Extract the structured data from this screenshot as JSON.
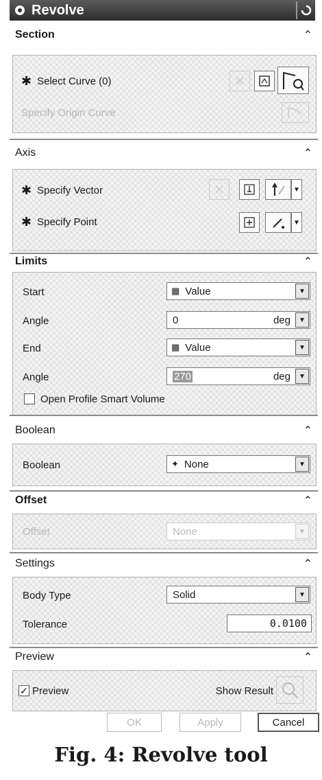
{
  "dialog": {
    "title": "Revolve"
  },
  "section": {
    "header": "Section",
    "select_curve": "Select Curve (0)",
    "specify_origin": "Specify Origin Curve"
  },
  "axis": {
    "header": "Axis",
    "specify_vector": "Specify Vector",
    "specify_point": "Specify Point"
  },
  "limits": {
    "header": "Limits",
    "start_label": "Start",
    "start_value": "Value",
    "angle1_label": "Angle",
    "angle1_value": "0",
    "angle1_unit": "deg",
    "end_label": "End",
    "end_value": "Value",
    "angle2_label": "Angle",
    "angle2_value": "270",
    "angle2_unit": "deg",
    "open_profile": "Open Profile Smart Volume"
  },
  "boolean": {
    "header": "Boolean",
    "label": "Boolean",
    "value": "None"
  },
  "offset": {
    "header": "Offset",
    "label": "Offset",
    "value": "None"
  },
  "settings": {
    "header": "Settings",
    "body_type_label": "Body Type",
    "body_type_value": "Solid",
    "tolerance_label": "Tolerance",
    "tolerance_value": "0.0100"
  },
  "preview": {
    "header": "Preview",
    "checkbox_label": "Preview",
    "checked": true,
    "show_result": "Show Result"
  },
  "buttons": {
    "ok": "OK",
    "apply": "Apply",
    "cancel": "Cancel"
  },
  "caption": "Fig. 4: Revolve tool"
}
